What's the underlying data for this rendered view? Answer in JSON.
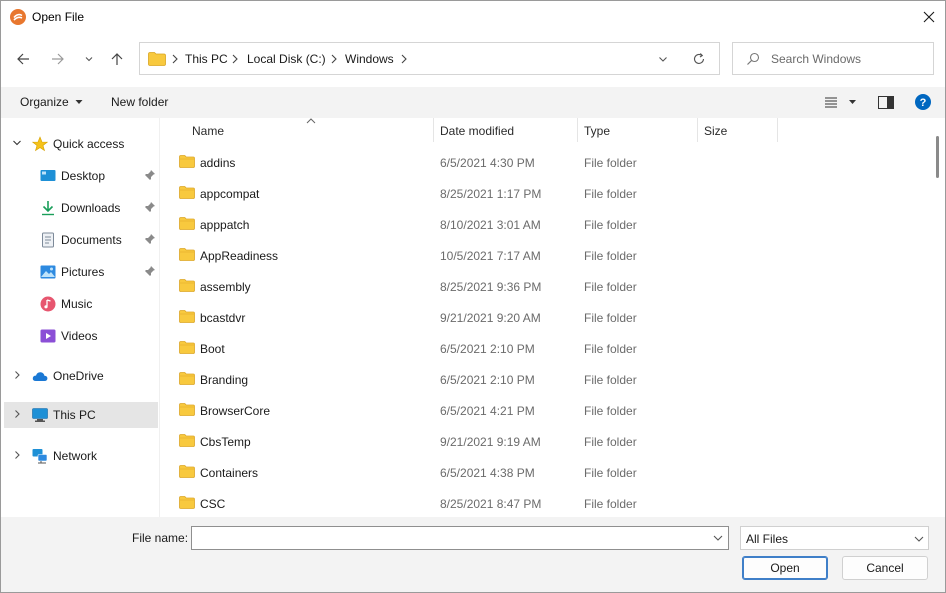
{
  "window": {
    "title": "Open File"
  },
  "address": {
    "crumbs": [
      "This PC",
      "Local Disk (C:)",
      "Windows"
    ]
  },
  "search": {
    "placeholder": "Search Windows"
  },
  "toolbar": {
    "organize_label": "Organize",
    "new_folder_label": "New folder",
    "help_label": "?"
  },
  "sidebar": {
    "items": [
      {
        "label": "Quick access"
      },
      {
        "label": "Desktop"
      },
      {
        "label": "Downloads"
      },
      {
        "label": "Documents"
      },
      {
        "label": "Pictures"
      },
      {
        "label": "Music"
      },
      {
        "label": "Videos"
      },
      {
        "label": "OneDrive"
      },
      {
        "label": "This PC"
      },
      {
        "label": "Network"
      }
    ]
  },
  "columns": {
    "name": "Name",
    "date": "Date modified",
    "type": "Type",
    "size": "Size"
  },
  "files": [
    {
      "name": "addins",
      "date": "6/5/2021 4:30 PM",
      "type": "File folder"
    },
    {
      "name": "appcompat",
      "date": "8/25/2021 1:17 PM",
      "type": "File folder"
    },
    {
      "name": "apppatch",
      "date": "8/10/2021 3:01 AM",
      "type": "File folder"
    },
    {
      "name": "AppReadiness",
      "date": "10/5/2021 7:17 AM",
      "type": "File folder"
    },
    {
      "name": "assembly",
      "date": "8/25/2021 9:36 PM",
      "type": "File folder"
    },
    {
      "name": "bcastdvr",
      "date": "9/21/2021 9:20 AM",
      "type": "File folder"
    },
    {
      "name": "Boot",
      "date": "6/5/2021 2:10 PM",
      "type": "File folder"
    },
    {
      "name": "Branding",
      "date": "6/5/2021 2:10 PM",
      "type": "File folder"
    },
    {
      "name": "BrowserCore",
      "date": "6/5/2021 4:21 PM",
      "type": "File folder"
    },
    {
      "name": "CbsTemp",
      "date": "9/21/2021 9:19 AM",
      "type": "File folder"
    },
    {
      "name": "Containers",
      "date": "6/5/2021 4:38 PM",
      "type": "File folder"
    },
    {
      "name": "CSC",
      "date": "8/25/2021 8:47 PM",
      "type": "File folder"
    }
  ],
  "footer": {
    "file_name_label": "File name:",
    "file_name_value": "",
    "filter_value": "All Files",
    "open_label": "Open",
    "cancel_label": "Cancel"
  },
  "colors": {
    "accent": "#0067c0",
    "folder": "#f8c93e",
    "selected_nav": "#e5e5e5"
  }
}
